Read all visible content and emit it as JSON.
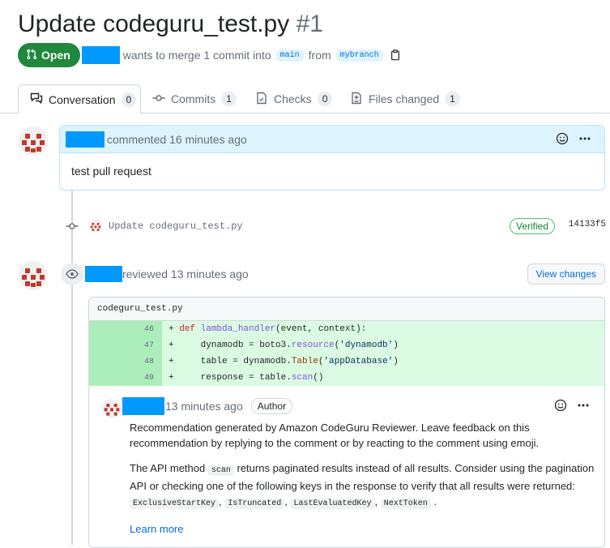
{
  "pr": {
    "title": "Update codeguru_test.py",
    "number": "#1",
    "state": "Open",
    "merge_text": "wants to merge 1 commit into",
    "base_branch": "main",
    "from_text": "from",
    "head_branch": "mybranch"
  },
  "tabs": [
    {
      "label": "Conversation",
      "count": "0"
    },
    {
      "label": "Commits",
      "count": "1"
    },
    {
      "label": "Checks",
      "count": "0"
    },
    {
      "label": "Files changed",
      "count": "1"
    }
  ],
  "comment": {
    "action": "commented 16 minutes ago",
    "body": "test pull request"
  },
  "commit": {
    "message": "Update codeguru_test.py",
    "verified": "Verified",
    "sha": "14133f5"
  },
  "review": {
    "action": "reviewed 13 minutes ago",
    "view_changes": "View changes",
    "filename": "codeguru_test.py",
    "diff_lines": [
      {
        "num": "46",
        "code": "def lambda_handler(event, context):"
      },
      {
        "num": "47",
        "code": "dynamodb = boto3.resource('dynamodb')"
      },
      {
        "num": "48",
        "code": "table = dynamodb.Table('appDatabase')"
      },
      {
        "num": "49",
        "code": "response = table.scan()"
      }
    ]
  },
  "inline_comment": {
    "time": "13 minutes ago",
    "role": "Author",
    "p1": "Recommendation generated by Amazon CodeGuru Reviewer. Leave feedback on this recommendation by replying to the comment or by reacting to the comment using emoji.",
    "p2_a": "The API method",
    "p2_code": "scan",
    "p2_b": "returns paginated results instead of all results. Consider using the pagination API or checking one of the following keys in the response to verify that all results were returned:",
    "keys": [
      "ExclusiveStartKey",
      "IsTruncated",
      "LastEvaluatedKey",
      "NextToken"
    ],
    "learn_more": "Learn more"
  },
  "colors": {
    "open_green": "#1f883d",
    "redaction": "#0099ff",
    "link_blue": "#0969da",
    "diff_add_bg": "#dafbe1"
  },
  "icons": [
    "pull-request-icon",
    "copy-icon",
    "comment-discussion-icon",
    "git-commit-icon",
    "checklist-icon",
    "file-diff-icon",
    "smiley-icon",
    "kebab-horizontal-icon",
    "eye-icon",
    "identicon-avatar"
  ]
}
